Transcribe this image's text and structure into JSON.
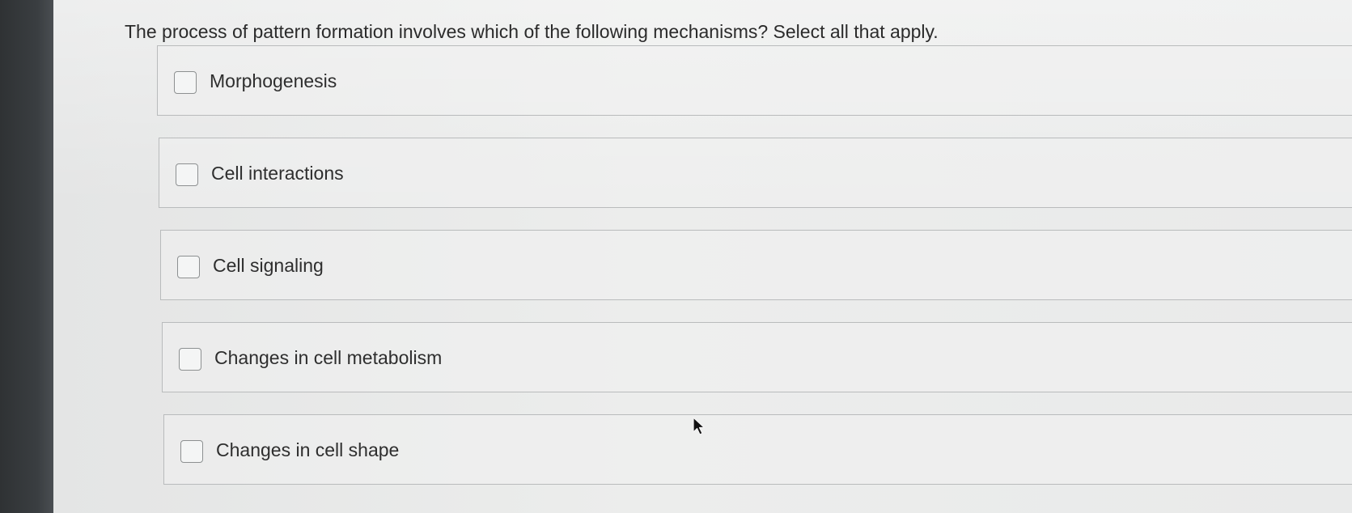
{
  "question": {
    "text": "The process of pattern formation involves which of the following mechanisms? Select all that apply."
  },
  "options": [
    {
      "label": "Morphogenesis",
      "checked": false
    },
    {
      "label": "Cell interactions",
      "checked": false
    },
    {
      "label": "Cell signaling",
      "checked": false
    },
    {
      "label": "Changes in cell metabolism",
      "checked": false
    },
    {
      "label": "Changes in cell shape",
      "checked": false
    }
  ],
  "icons": {
    "cursor": "arrow-cursor-icon"
  }
}
